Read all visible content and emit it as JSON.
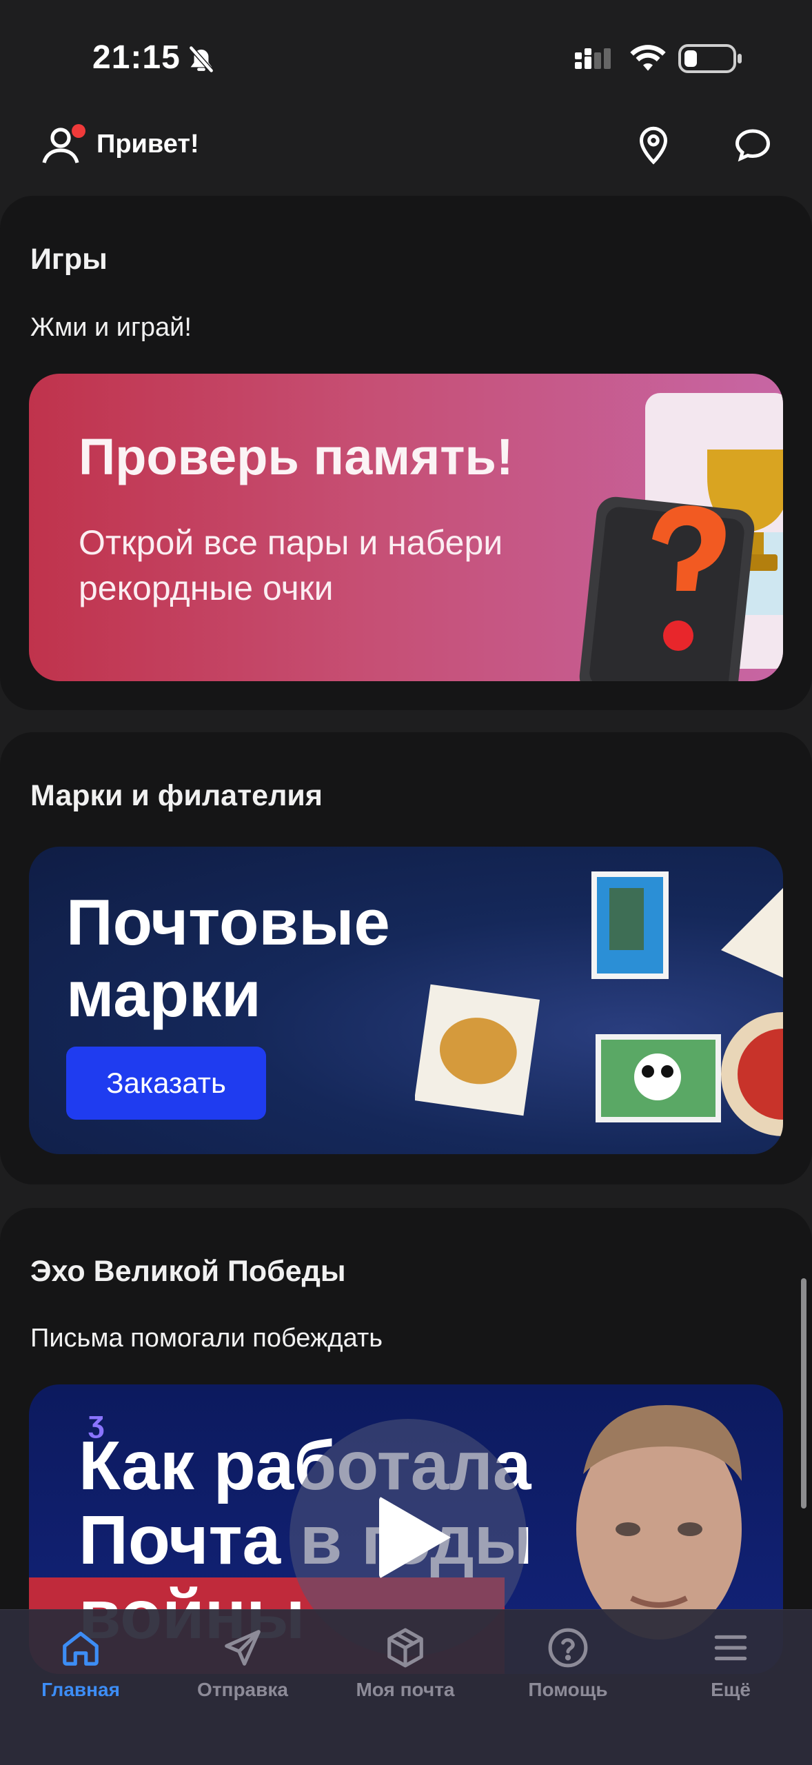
{
  "status_bar": {
    "time": "21:15"
  },
  "header": {
    "greeting": "Привет!"
  },
  "games": {
    "title": "Игры",
    "subtitle": "Жми и играй!",
    "banner_title": "Проверь память!",
    "banner_text": "Открой все пары и набери рекордные очки"
  },
  "stamps": {
    "title": "Марки и филателия",
    "banner_title": "Почтовые марки",
    "order_button": "Заказать"
  },
  "victory": {
    "title": "Эхо Великой Победы",
    "subtitle": "Письма помогали побеждать",
    "video_title": "Как работала Почта в годы войны"
  },
  "bottom_nav": {
    "items": [
      {
        "label": "Главная",
        "icon": "home-icon",
        "active": true
      },
      {
        "label": "Отправка",
        "icon": "send-icon",
        "active": false
      },
      {
        "label": "Моя почта",
        "icon": "package-icon",
        "active": false
      },
      {
        "label": "Помощь",
        "icon": "help-icon",
        "active": false
      },
      {
        "label": "Ещё",
        "icon": "menu-icon",
        "active": false
      }
    ]
  },
  "colors": {
    "accent": "#3d8df5",
    "nav_inactive": "#8d8b98",
    "order_button": "#1f3cf0"
  }
}
